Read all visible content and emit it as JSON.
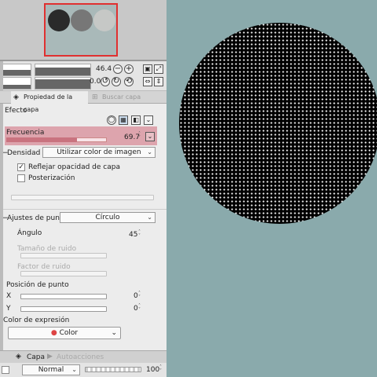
{
  "navigator": {
    "swatches": [
      {
        "name": "black",
        "color": "#2a2a2a"
      },
      {
        "name": "gray",
        "color": "#777777"
      },
      {
        "name": "light-gray",
        "color": "#c6c8c6"
      }
    ]
  },
  "toolbar": {
    "zoom": "46.4",
    "rotation": "0.0"
  },
  "tabs": {
    "properties": "Propiedad de la capa",
    "search": "Buscar capa"
  },
  "effect": {
    "title": "Efecto",
    "frequency_label": "Frecuencia",
    "frequency_value": "69.7",
    "frequency_fraction": 0.7,
    "density_label": "Densidad",
    "density_option": "Utilizar color de imagen",
    "reflect_label": "Reflejar opacidad de capa",
    "reflect_checked": true,
    "posterize_label": "Posterización",
    "posterize_checked": false
  },
  "dot_settings": {
    "label": "Ajustes de punto",
    "shape": "Círculo",
    "angle_label": "Ángulo",
    "angle_value": "45",
    "noise_size_label": "Tamaño de ruido",
    "noise_factor_label": "Factor de ruido",
    "position_label": "Posición de punto",
    "x_label": "X",
    "x_value": "0",
    "y_label": "Y",
    "y_value": "0"
  },
  "expression": {
    "label": "Color de expresión",
    "value": "Color"
  },
  "layer_panel": {
    "tab_layer": "Capa",
    "tab_autoaction": "Autoacciones",
    "blend_mode": "Normal",
    "opacity": "100"
  },
  "canvas": {
    "background": "#8aaaac",
    "circle_fill": "#000000",
    "dot_color": "#ffffff"
  }
}
